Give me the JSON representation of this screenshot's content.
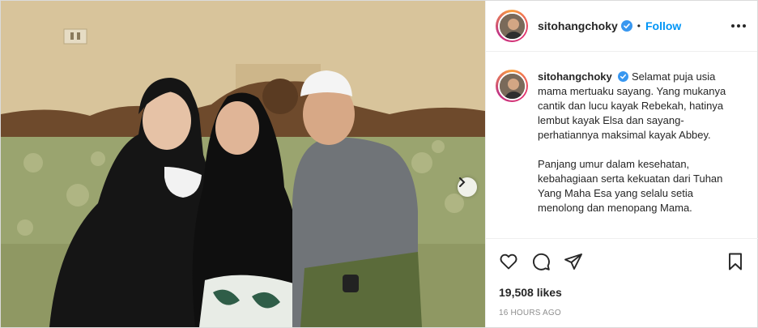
{
  "post": {
    "username": "sitohangchoky",
    "follow_label": "Follow",
    "separator": "•",
    "caption": {
      "username": "sitohangchoky",
      "paragraphs": [
        "Selamat puja usia mama mertuaku sayang. Yang mukanya cantik dan lucu kayak Rebekah, hatinya lembut kayak Elsa dan sayang-perhatiannya maksimal kayak Abbey.",
        "Panjang umur dalam kesehatan, kebahagiaan serta kekuatan dari Tuhan Yang Maha Esa yang selalu setia menolong dan menopang Mama."
      ]
    },
    "likes": "19,508 likes",
    "timestamp": "16 HOURS AGO"
  },
  "icons": {
    "verified": "verified-badge-icon",
    "more": "more-options-icon",
    "like": "heart-icon",
    "comment": "comment-icon",
    "share": "paper-plane-icon",
    "save": "bookmark-icon",
    "next": "chevron-right-icon"
  },
  "colors": {
    "link_blue": "#0095f6",
    "text": "#262626",
    "muted": "#8e8e8e"
  }
}
